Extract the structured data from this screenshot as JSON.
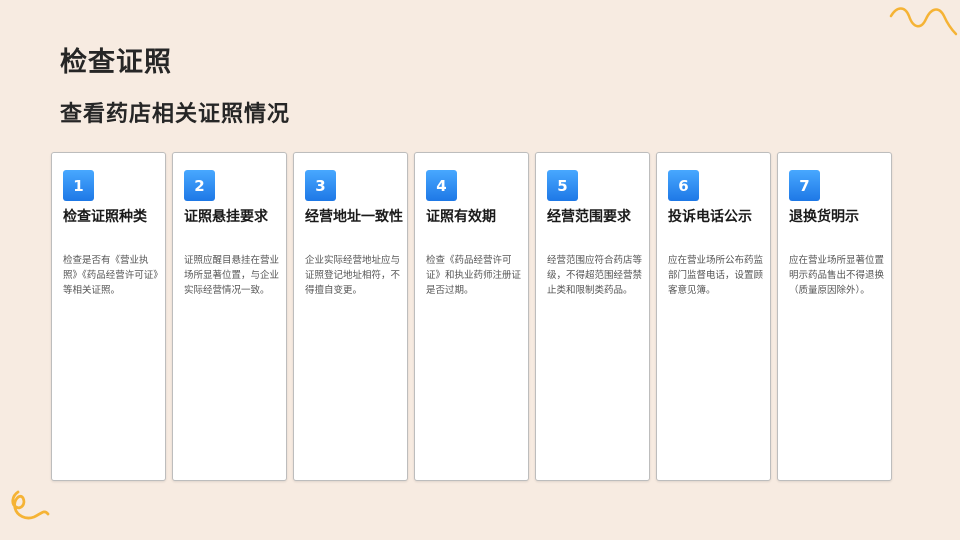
{
  "title": "检查证照",
  "subtitle": "查看药店相关证照情况",
  "colors": {
    "background": "#f7ebe1",
    "badge": "#1e78e6",
    "decoration": "#f5b335"
  },
  "cards": [
    {
      "number": "1",
      "title": "检查证照种类",
      "description": "检查是否有《营业执照》《药品经营许可证》等相关证照。"
    },
    {
      "number": "2",
      "title": "证照悬挂要求",
      "description": "证照应醒目悬挂在营业场所显著位置，与企业实际经营情况一致。"
    },
    {
      "number": "3",
      "title": "经营地址一致性",
      "description": "企业实际经营地址应与证照登记地址相符，不得擅自变更。"
    },
    {
      "number": "4",
      "title": "证照有效期",
      "description": "检查《药品经营许可证》和执业药师注册证是否过期。"
    },
    {
      "number": "5",
      "title": "经营范围要求",
      "description": "经营范围应符合药店等级，不得超范围经营禁止类和限制类药品。"
    },
    {
      "number": "6",
      "title": "投诉电话公示",
      "description": "应在营业场所公布药监部门监督电话，设置顾客意见簿。"
    },
    {
      "number": "7",
      "title": "退换货明示",
      "description": "应在营业场所显著位置明示药品售出不得退换（质量原因除外）。"
    }
  ]
}
